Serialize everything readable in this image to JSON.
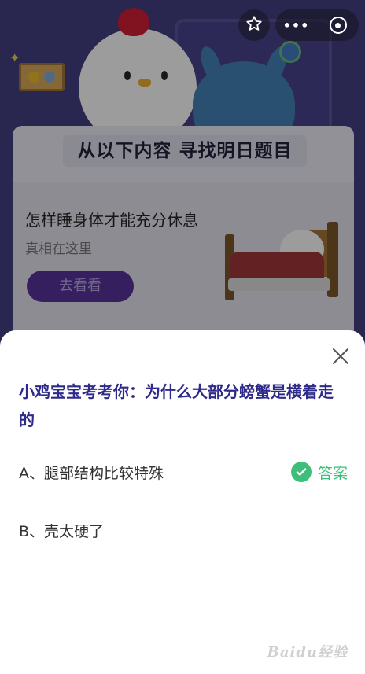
{
  "background_page": {
    "heading": "从以下内容 寻找明日题目",
    "card_title": "怎样睡身体才能充分休息",
    "card_subtitle": "真相在这里",
    "card_button": "去看看"
  },
  "top_controls": {
    "favorite_icon": "star-icon",
    "more_icon": "more-dots-icon",
    "more_label": "•••",
    "exit_icon": "close-circle-icon"
  },
  "quiz": {
    "close_icon": "close-icon",
    "question": "小鸡宝宝考考你：为什么大部分螃蟹是横着走的",
    "options": [
      {
        "label": "A、腿部结构比较特殊",
        "is_answer": true
      },
      {
        "label": "B、壳太硬了",
        "is_answer": false
      }
    ],
    "answer_label": "答案",
    "answer_icon": "check-circle-icon"
  },
  "watermark": "Baidu经验",
  "colors": {
    "question_text": "#2e2a8a",
    "answer_green": "#3dbf7a",
    "button_purple": "#4a2b84"
  }
}
